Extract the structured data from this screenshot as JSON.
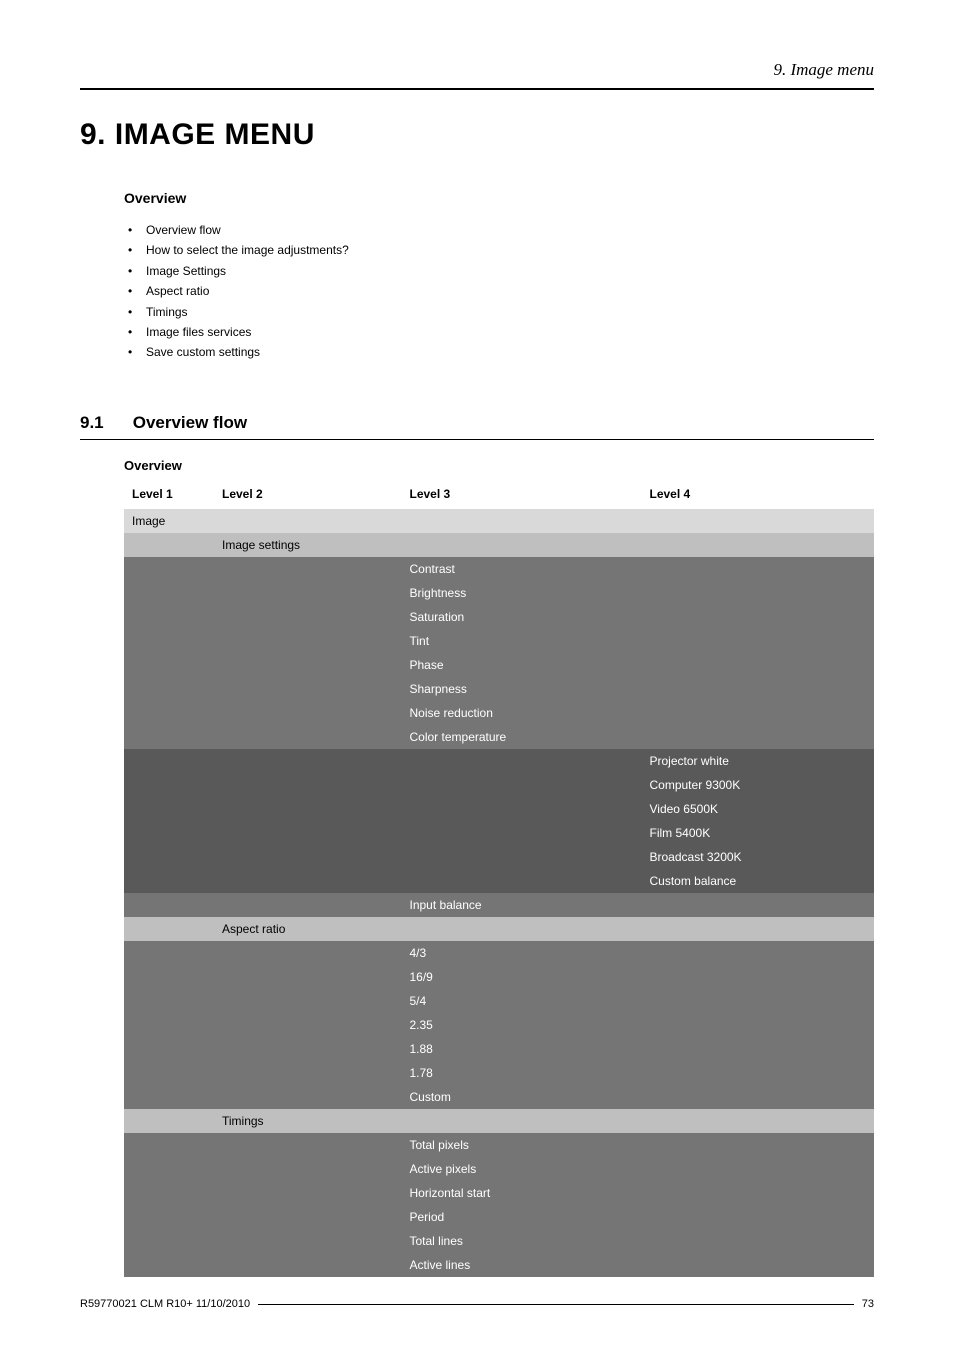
{
  "header": {
    "chapter_ref": "9. Image menu"
  },
  "title": "9. IMAGE MENU",
  "overview_label": "Overview",
  "toc": [
    "Overview flow",
    "How to select the image adjustments?",
    "Image Settings",
    "Aspect ratio",
    "Timings",
    "Image files services",
    "Save custom settings"
  ],
  "section": {
    "number": "9.1",
    "title": "Overview flow",
    "sub_label": "Overview"
  },
  "table": {
    "headers": {
      "c1": "Level 1",
      "c2": "Level 2",
      "c3": "Level 3",
      "c4": "Level 4"
    },
    "rows": [
      {
        "cls": "light",
        "c1": "Image",
        "c2": "",
        "c3": "",
        "c4": ""
      },
      {
        "cls": "med",
        "c1": "",
        "c2": "Image settings",
        "c3": "",
        "c4": ""
      },
      {
        "cls": "dark",
        "c1": "",
        "c2": "",
        "c3": "Contrast",
        "c4": ""
      },
      {
        "cls": "dark",
        "c1": "",
        "c2": "",
        "c3": "Brightness",
        "c4": ""
      },
      {
        "cls": "dark",
        "c1": "",
        "c2": "",
        "c3": "Saturation",
        "c4": ""
      },
      {
        "cls": "dark",
        "c1": "",
        "c2": "",
        "c3": "Tint",
        "c4": ""
      },
      {
        "cls": "dark",
        "c1": "",
        "c2": "",
        "c3": "Phase",
        "c4": ""
      },
      {
        "cls": "dark",
        "c1": "",
        "c2": "",
        "c3": "Sharpness",
        "c4": ""
      },
      {
        "cls": "dark",
        "c1": "",
        "c2": "",
        "c3": "Noise reduction",
        "c4": ""
      },
      {
        "cls": "dark",
        "c1": "",
        "c2": "",
        "c3": "Color temperature",
        "c4": ""
      },
      {
        "cls": "vdark",
        "c1": "",
        "c2": "",
        "c3": "",
        "c4": "Projector white"
      },
      {
        "cls": "vdark",
        "c1": "",
        "c2": "",
        "c3": "",
        "c4": "Computer 9300K"
      },
      {
        "cls": "vdark",
        "c1": "",
        "c2": "",
        "c3": "",
        "c4": "Video 6500K"
      },
      {
        "cls": "vdark",
        "c1": "",
        "c2": "",
        "c3": "",
        "c4": "Film 5400K"
      },
      {
        "cls": "vdark",
        "c1": "",
        "c2": "",
        "c3": "",
        "c4": "Broadcast 3200K"
      },
      {
        "cls": "vdark",
        "c1": "",
        "c2": "",
        "c3": "",
        "c4": "Custom balance"
      },
      {
        "cls": "dark",
        "c1": "",
        "c2": "",
        "c3": "Input balance",
        "c4": ""
      },
      {
        "cls": "med",
        "c1": "",
        "c2": "Aspect ratio",
        "c3": "",
        "c4": ""
      },
      {
        "cls": "dark",
        "c1": "",
        "c2": "",
        "c3": "4/3",
        "c4": ""
      },
      {
        "cls": "dark",
        "c1": "",
        "c2": "",
        "c3": "16/9",
        "c4": ""
      },
      {
        "cls": "dark",
        "c1": "",
        "c2": "",
        "c3": "5/4",
        "c4": ""
      },
      {
        "cls": "dark",
        "c1": "",
        "c2": "",
        "c3": "2.35",
        "c4": ""
      },
      {
        "cls": "dark",
        "c1": "",
        "c2": "",
        "c3": "1.88",
        "c4": ""
      },
      {
        "cls": "dark",
        "c1": "",
        "c2": "",
        "c3": "1.78",
        "c4": ""
      },
      {
        "cls": "dark",
        "c1": "",
        "c2": "",
        "c3": "Custom",
        "c4": ""
      },
      {
        "cls": "med",
        "c1": "",
        "c2": "Timings",
        "c3": "",
        "c4": ""
      },
      {
        "cls": "dark",
        "c1": "",
        "c2": "",
        "c3": "Total pixels",
        "c4": ""
      },
      {
        "cls": "dark",
        "c1": "",
        "c2": "",
        "c3": "Active pixels",
        "c4": ""
      },
      {
        "cls": "dark",
        "c1": "",
        "c2": "",
        "c3": "Horizontal start",
        "c4": ""
      },
      {
        "cls": "dark",
        "c1": "",
        "c2": "",
        "c3": "Period",
        "c4": ""
      },
      {
        "cls": "dark",
        "c1": "",
        "c2": "",
        "c3": "Total lines",
        "c4": ""
      },
      {
        "cls": "dark",
        "c1": "",
        "c2": "",
        "c3": "Active lines",
        "c4": ""
      }
    ]
  },
  "footer": {
    "left": "R59770021  CLM R10+  11/10/2010",
    "right": "73"
  }
}
